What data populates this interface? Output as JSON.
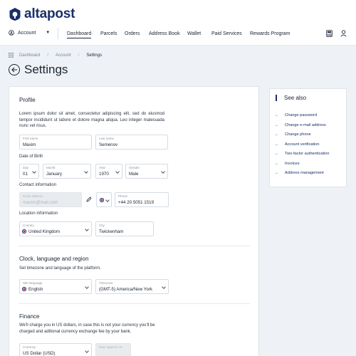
{
  "brand": {
    "name": "altapost",
    "color": "#1a2f6b"
  },
  "header": {
    "account_label": "Account",
    "nav": [
      "Dashboard",
      "Parcels",
      "Orders",
      "Address Book",
      "Wallet",
      "Paid Services",
      "Rewards Program"
    ],
    "active_nav": "Dashboard",
    "icons": [
      "calculator-icon",
      "user-icon"
    ]
  },
  "breadcrumb": [
    "Dashboard",
    "Account",
    "Settings"
  ],
  "page_title": "Settings",
  "profile": {
    "title": "Profile",
    "description": "Lorem ipsum dolor sit amet, consectetur adipiscing elit, sed do eiusmod tempor incididunt ut labore et dolore magna aliqua. Leo integer malesuada nunc vel risus.",
    "first_name": {
      "label": "First name",
      "value": "Maxim"
    },
    "last_name": {
      "label": "Last name",
      "value": "Semenov"
    },
    "dob_label": "Date of Birth",
    "day": {
      "label": "Day",
      "value": "01"
    },
    "month": {
      "label": "Month",
      "value": "January"
    },
    "year": {
      "label": "Year",
      "value": "1970"
    },
    "gender": {
      "label": "Gender",
      "value": "Male"
    },
    "contact_label": "Contact information",
    "email": {
      "label": "Email address",
      "value": "maxim@mail.com"
    },
    "phone": {
      "label": "Phone",
      "value": "+44 20 5051 1519"
    },
    "location_label": "Location information",
    "country": {
      "label": "Country",
      "value": "United Kingdom"
    },
    "city": {
      "label": "City",
      "value": "Twickenham"
    }
  },
  "clock": {
    "title": "Clock, language and region",
    "description": "Set timezone and language of the platform.",
    "site_language": {
      "label": "Site language",
      "value": "English"
    },
    "timezone": {
      "label": "Timezone",
      "value": "(GMT-5) America/New York"
    }
  },
  "finance": {
    "title": "Finance",
    "description": "We'll charge you in US dollars, in case this is not your currency you'll be charged and aditional currency exchange fee by your bank.",
    "currency": {
      "label": "Currency",
      "value": "US Dollar (USD)"
    },
    "exchange_rate": {
      "label": "Rate against US"
    }
  },
  "see_also": {
    "title": "See also",
    "links": [
      "Change password",
      "Change e-mail address",
      "Change phone",
      "Account verification",
      "Two-factor authentication",
      "Invoices",
      "Address management"
    ]
  }
}
